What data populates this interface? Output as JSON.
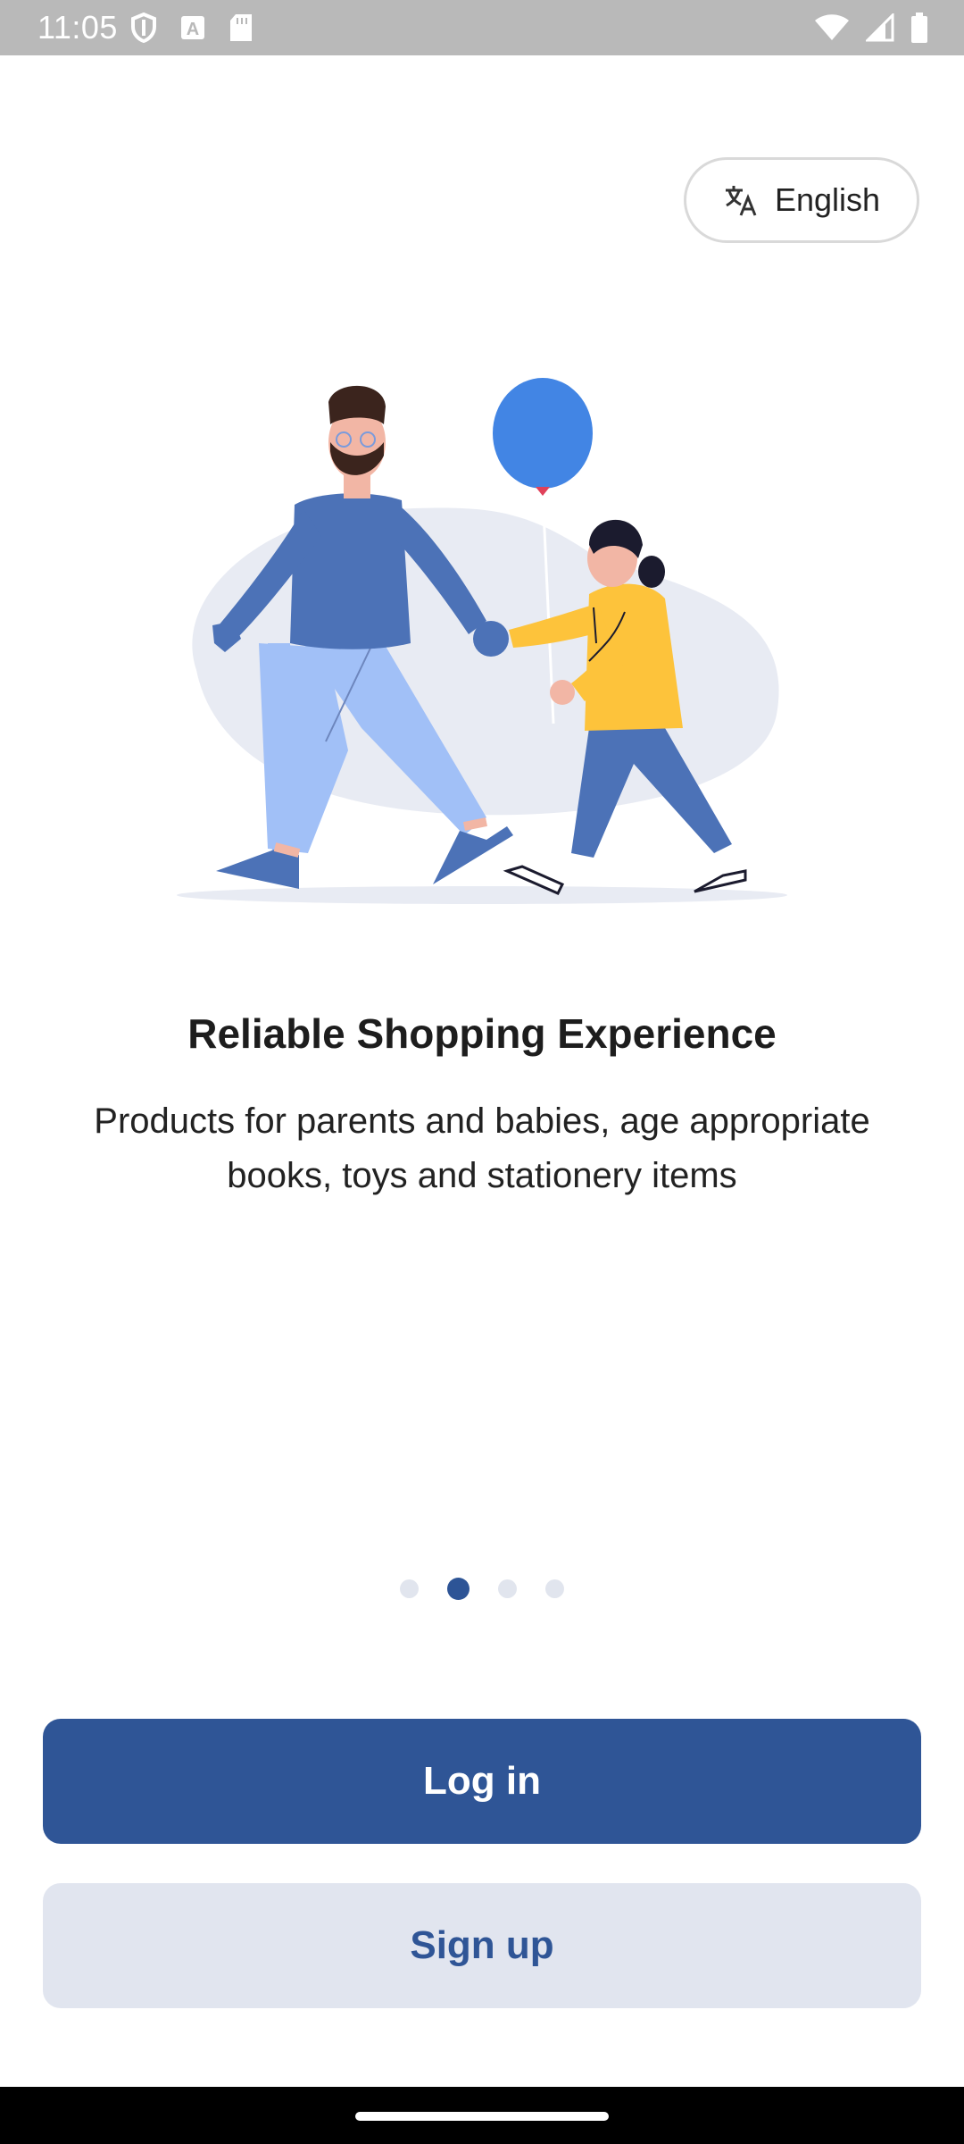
{
  "status_bar": {
    "time": "11:05",
    "left_icons": [
      "shield-icon",
      "a-badge-icon",
      "sd-card-icon"
    ],
    "right_icons": [
      "wifi-icon",
      "signal-icon",
      "battery-icon"
    ]
  },
  "language": {
    "label": "English",
    "icon": "translate-icon"
  },
  "onboarding": {
    "title": "Reliable Shopping Experience",
    "description": "Products for parents and babies, age appropriate books, toys and stationery items",
    "illustration": "father-and-daughter-with-balloon",
    "page_count": 4,
    "active_page": 2
  },
  "actions": {
    "login_label": "Log in",
    "signup_label": "Sign up"
  },
  "colors": {
    "primary": "#2f5596",
    "secondary_bg": "#e1e5ef",
    "dot_inactive": "#e1e5ee"
  }
}
